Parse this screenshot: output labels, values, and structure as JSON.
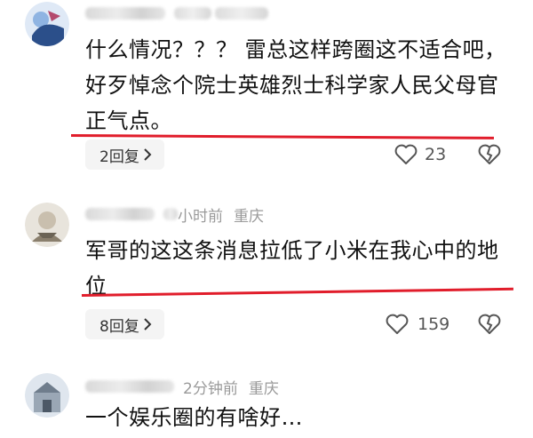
{
  "comments": [
    {
      "meta_trail": "",
      "text": "什么情况？？？ 雷总这样跨圈这不适合吧，好歹悼念个院士英雄烈士科学家人民父母官正气点。",
      "reply_label": "2回复",
      "like_count": "23",
      "underline_color": "#e11d2b"
    },
    {
      "meta_time": "小时前",
      "meta_location": "重庆",
      "text": "军哥的这这条消息拉低了小米在我心中的地位",
      "reply_label": "8回复",
      "like_count": "159",
      "underline_color": "#e11d2b"
    },
    {
      "meta_time": "2分钟前",
      "meta_location": "重庆",
      "text": "一个娱乐圈的有啥好…"
    }
  ],
  "icons": {
    "reply_chevron": "chevron-right-icon",
    "like": "heart-icon",
    "dislike": "broken-heart-icon"
  }
}
